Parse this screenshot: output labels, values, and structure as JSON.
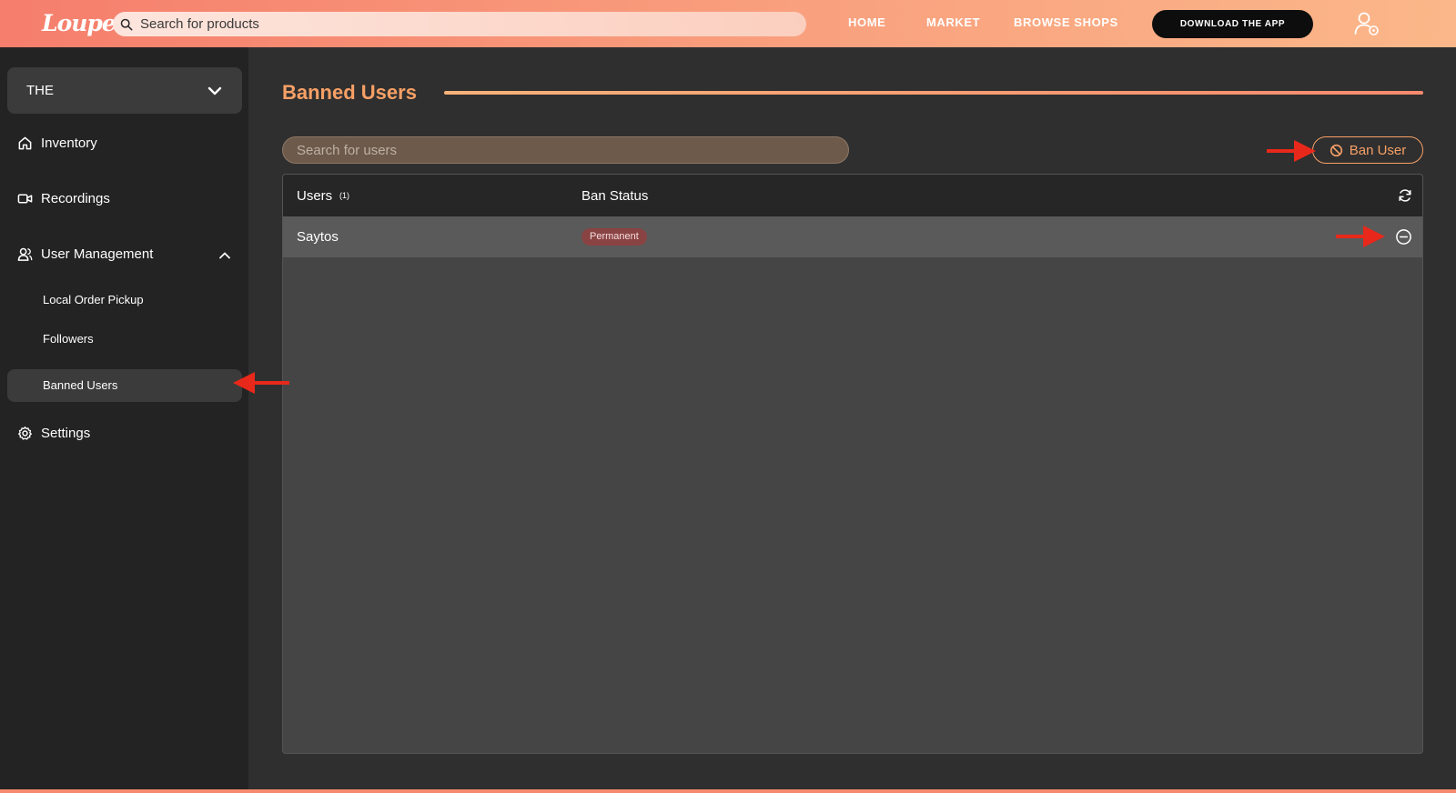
{
  "header": {
    "logo_text": "Loupe",
    "search_placeholder": "Search for products",
    "nav": [
      "HOME",
      "MARKET",
      "BROWSE SHOPS"
    ],
    "download_label": "DOWNLOAD THE APP",
    "icons": {
      "search": "search-icon",
      "account": "user-settings-icon"
    }
  },
  "sidebar": {
    "store_selector": "THE",
    "items": [
      {
        "label": "Inventory",
        "icon": "home-icon"
      },
      {
        "label": "Recordings",
        "icon": "video-icon"
      },
      {
        "label": "User Management",
        "icon": "users-icon",
        "expanded": true
      },
      {
        "label": "Settings",
        "icon": "gear-icon"
      }
    ],
    "sub_items": [
      "Local Order Pickup",
      "Followers",
      "Banned Users"
    ],
    "active_sub_item": "Banned Users"
  },
  "main": {
    "title": "Banned Users",
    "search_placeholder": "Search for users",
    "ban_button_label": "Ban User",
    "table": {
      "columns": [
        "Users",
        "Ban Status"
      ],
      "user_count": "(1)",
      "rows": [
        {
          "user": "Saytos",
          "status": "Permanent"
        }
      ]
    }
  },
  "colors": {
    "accent": "#f7a066",
    "header_gradient_start": "#f57e6c",
    "header_gradient_end": "#fbb789",
    "badge_bg": "#8a4343",
    "annotation_arrow": "#e8281a"
  }
}
